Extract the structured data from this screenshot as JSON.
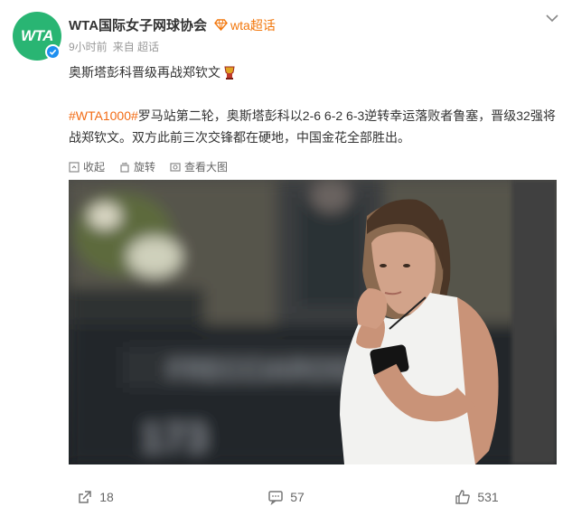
{
  "post": {
    "author": "WTA国际女子网球协会",
    "avatar_text": "WTA",
    "topic_tag": "wta超话",
    "time": "9小时前",
    "source": "来自 超话",
    "title": "奥斯塔彭科晋级再战郑钦文",
    "hashtag": "#WTA1000#",
    "body": "罗马站第二轮，奥斯塔彭科以2-6 6-2 6-3逆转幸运落败者鲁塞，晋级32强将战郑钦文。双方此前三次交锋都在硬地，中国金花全部胜出。"
  },
  "tools": {
    "collect": "收起",
    "rotate": "旋转",
    "view_large": "查看大图"
  },
  "footer": {
    "repost_count": "18",
    "comment_count": "57",
    "like_count": "531"
  },
  "colors": {
    "accent_orange": "#f26b14",
    "avatar_green": "#29b573",
    "verified_blue": "#1d8ff0"
  }
}
